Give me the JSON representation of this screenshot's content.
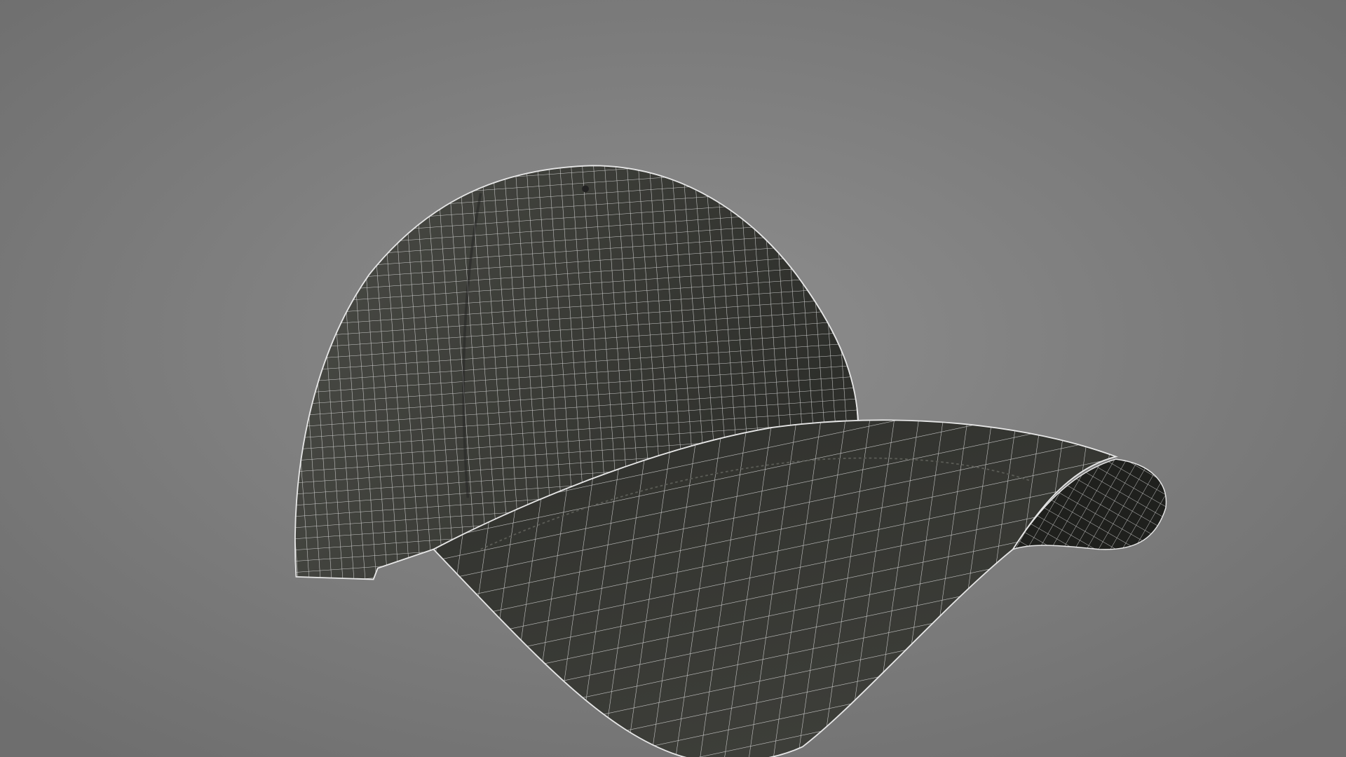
{
  "scene": {
    "subject": "baseball-cap-wireframe",
    "colors": {
      "background_center": "#8c8c8c",
      "background_edge": "#6f6f6f",
      "fabric": "#3a3b36",
      "fabric_dark": "#242521",
      "underside": "#1e1f1c",
      "wire": "#e8e8e8"
    }
  }
}
